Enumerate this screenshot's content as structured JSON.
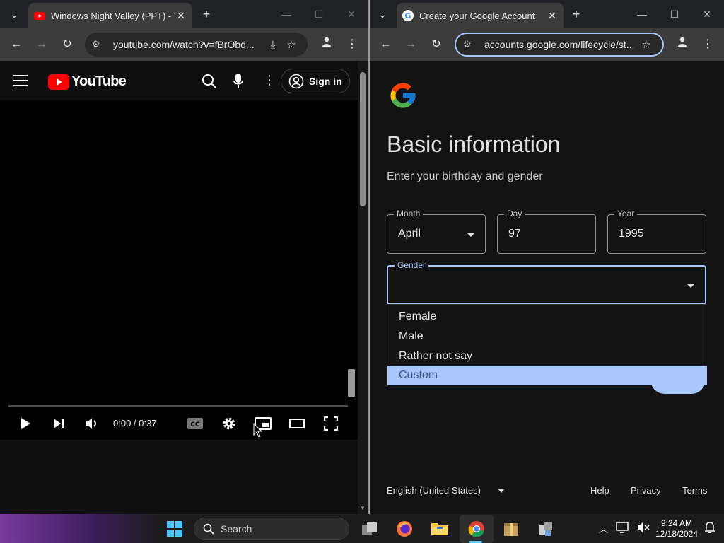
{
  "left_window": {
    "tab_title": "Windows Night Valley (PPT) - YouTube",
    "url": "youtube.com/watch?v=fBrObd...",
    "youtube": {
      "logo_text": "YouTube",
      "sign_in_label": "Sign in",
      "time_display": "0:00 / 0:37"
    }
  },
  "right_window": {
    "tab_title": "Create your Google Account",
    "url": "accounts.google.com/lifecycle/st...",
    "form": {
      "title": "Basic information",
      "subtitle": "Enter your birthday and gender",
      "month": {
        "label": "Month",
        "value": "April"
      },
      "day": {
        "label": "Day",
        "value": "97"
      },
      "year": {
        "label": "Year",
        "value": "1995"
      },
      "gender": {
        "label": "Gender",
        "value": ""
      },
      "gender_options": [
        "Female",
        "Male",
        "Rather not say",
        "Custom"
      ],
      "selected_option": "Custom"
    },
    "footer": {
      "language": "English (United States)",
      "help": "Help",
      "privacy": "Privacy",
      "terms": "Terms"
    }
  },
  "taskbar": {
    "search_placeholder": "Search",
    "time": "9:24 AM",
    "date": "12/18/2024",
    "apps": [
      "windows-start",
      "task-view",
      "firefox",
      "file-explorer",
      "chrome",
      "app-archive",
      "app-installer"
    ]
  },
  "colors": {
    "youtube_red": "#ff0000",
    "google_accent": "#a8c7fa",
    "page_dark": "#131314"
  }
}
